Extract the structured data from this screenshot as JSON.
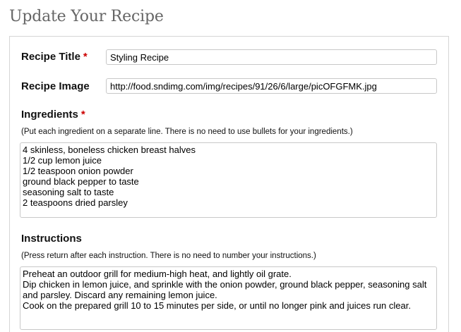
{
  "page": {
    "title": "Update Your Recipe"
  },
  "form": {
    "recipe_title": {
      "label": "Recipe Title",
      "required_mark": "*",
      "value": "Styling Recipe"
    },
    "recipe_image": {
      "label": "Recipe Image",
      "value": "http://food.sndimg.com/img/recipes/91/26/6/large/picOFGFMK.jpg"
    },
    "ingredients": {
      "label": "Ingredients",
      "required_mark": "*",
      "hint": "(Put each ingredient on a separate line. There is no need to use bullets for your ingredients.)",
      "lines": [
        "4 skinless, boneless chicken breast halves",
        "1/2 cup lemon juice",
        "1/2 teaspoon onion powder",
        "ground black pepper to taste",
        "seasoning salt to taste",
        "2 teaspoons dried parsley"
      ]
    },
    "instructions": {
      "label": "Instructions",
      "hint": "(Press return after each instruction. There is no need to number your instructions.)",
      "lines": [
        "Preheat an outdoor grill for medium-high heat, and lightly oil grate.",
        "Dip chicken in lemon juice, and sprinkle with the onion powder, ground black pepper, seasoning salt and parsley. Discard any remaining lemon juice.",
        "Cook on the prepared grill 10 to 15 minutes per side, or until no longer pink and juices run clear."
      ]
    }
  }
}
